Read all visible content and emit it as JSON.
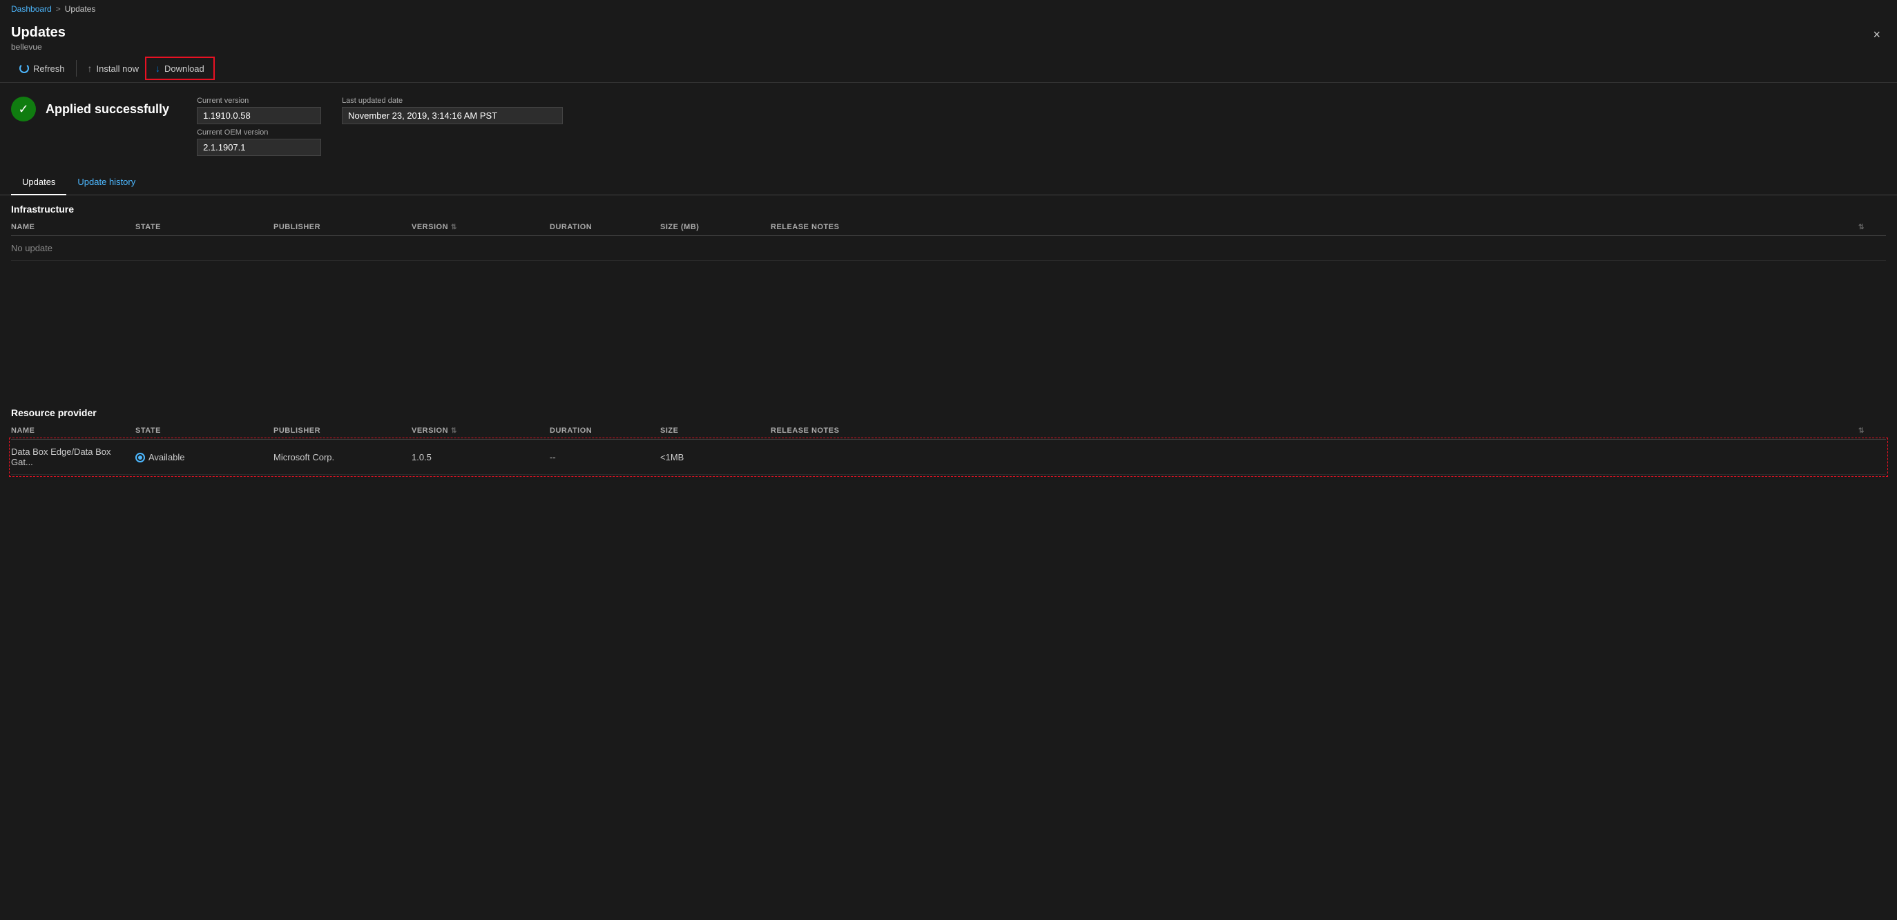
{
  "breadcrumb": {
    "link_label": "Dashboard",
    "separator": ">",
    "current": "Updates"
  },
  "panel": {
    "title": "Updates",
    "subtitle": "bellevue",
    "close_label": "×"
  },
  "toolbar": {
    "refresh_label": "Refresh",
    "install_label": "Install now",
    "download_label": "Download"
  },
  "status": {
    "text": "Applied successfully",
    "current_version_label": "Current version",
    "current_version_value": "1.1910.0.58",
    "current_oem_label": "Current OEM version",
    "current_oem_value": "2.1.1907.1",
    "last_updated_label": "Last updated date",
    "last_updated_value": "November 23, 2019, 3:14:16 AM PST"
  },
  "tabs": [
    {
      "id": "updates",
      "label": "Updates",
      "active": true
    },
    {
      "id": "update-history",
      "label": "Update history",
      "active": false
    }
  ],
  "infrastructure": {
    "section_title": "Infrastructure",
    "columns": [
      {
        "id": "name",
        "label": "NAME"
      },
      {
        "id": "state",
        "label": "STATE"
      },
      {
        "id": "publisher",
        "label": "PUBLISHER"
      },
      {
        "id": "version",
        "label": "VERSION"
      },
      {
        "id": "duration",
        "label": "DURATION"
      },
      {
        "id": "size_mb",
        "label": "SIZE (MB)"
      },
      {
        "id": "release_notes",
        "label": "RELEASE NOTES"
      }
    ],
    "rows": [
      {
        "name": "No update",
        "state": "",
        "publisher": "",
        "version": "",
        "duration": "",
        "size_mb": "",
        "release_notes": ""
      }
    ]
  },
  "resource_provider": {
    "section_title": "Resource provider",
    "columns": [
      {
        "id": "name",
        "label": "NAME"
      },
      {
        "id": "state",
        "label": "STATE"
      },
      {
        "id": "publisher",
        "label": "PUBLISHER"
      },
      {
        "id": "version",
        "label": "VERSION"
      },
      {
        "id": "duration",
        "label": "DURATION"
      },
      {
        "id": "size",
        "label": "SIZE"
      },
      {
        "id": "release_notes",
        "label": "RELEASE NOTES"
      }
    ],
    "rows": [
      {
        "name": "Data Box Edge/Data Box Gat...",
        "state": "Available",
        "publisher": "Microsoft Corp.",
        "version": "1.0.5",
        "duration": "--",
        "size": "<1MB",
        "release_notes": "",
        "highlighted": true
      }
    ]
  }
}
